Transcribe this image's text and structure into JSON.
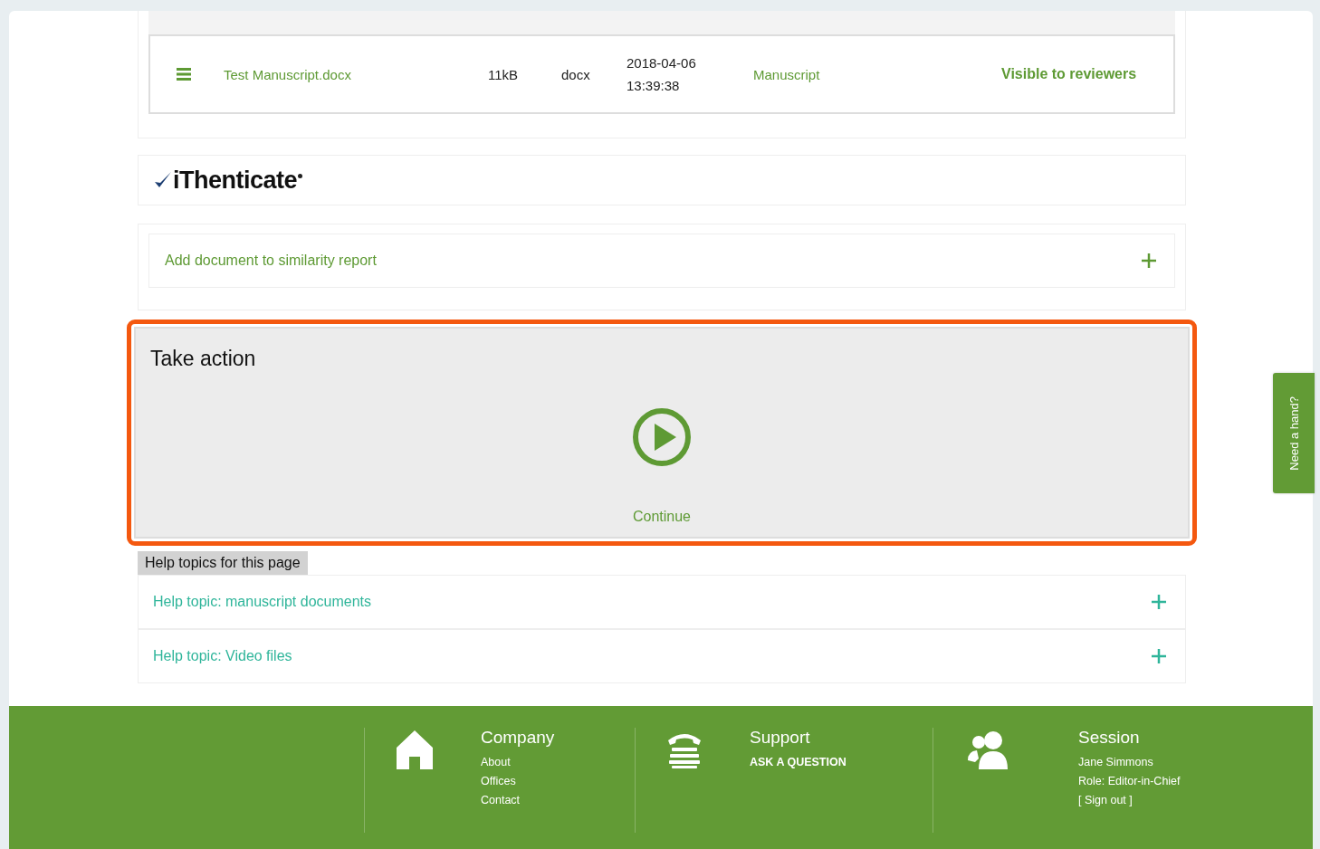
{
  "files": {
    "rows": [
      {
        "name": "Test Manuscript.docx",
        "size": "11kB",
        "ext": "docx",
        "datetime": "2018-04-06 13:39:38",
        "type": "Manuscript",
        "visibility": "Visible to reviewers"
      }
    ]
  },
  "similarity": {
    "logo": "iThenticate",
    "add_label": "Add document to similarity report"
  },
  "take_action": {
    "title": "Take action",
    "highlighted": true,
    "action": "Continue"
  },
  "help": {
    "heading": "Help topics for this page",
    "topics": [
      {
        "label": "Help topic: manuscript documents",
        "expanded": false
      },
      {
        "label": "Help topic: Video files",
        "expanded": false
      }
    ]
  },
  "help_tab": "Need a hand?",
  "footer": {
    "columns": [
      {
        "kind": "home",
        "title": "Company",
        "links": [
          {
            "text": "About",
            "strong": false
          },
          {
            "text": "Offices",
            "strong": false
          },
          {
            "text": "Contact",
            "strong": false
          }
        ]
      },
      {
        "kind": "phone",
        "title": "Support",
        "links": [
          {
            "text": "ASK A QUESTION",
            "strong": true
          }
        ]
      },
      {
        "kind": "users",
        "title": "Session",
        "links": [
          {
            "text": "Jane Simmons",
            "strong": false
          },
          {
            "text": "Role: Editor-in-Chief",
            "strong": false
          },
          {
            "text": "[ Sign out ]",
            "strong": false
          }
        ]
      }
    ]
  }
}
